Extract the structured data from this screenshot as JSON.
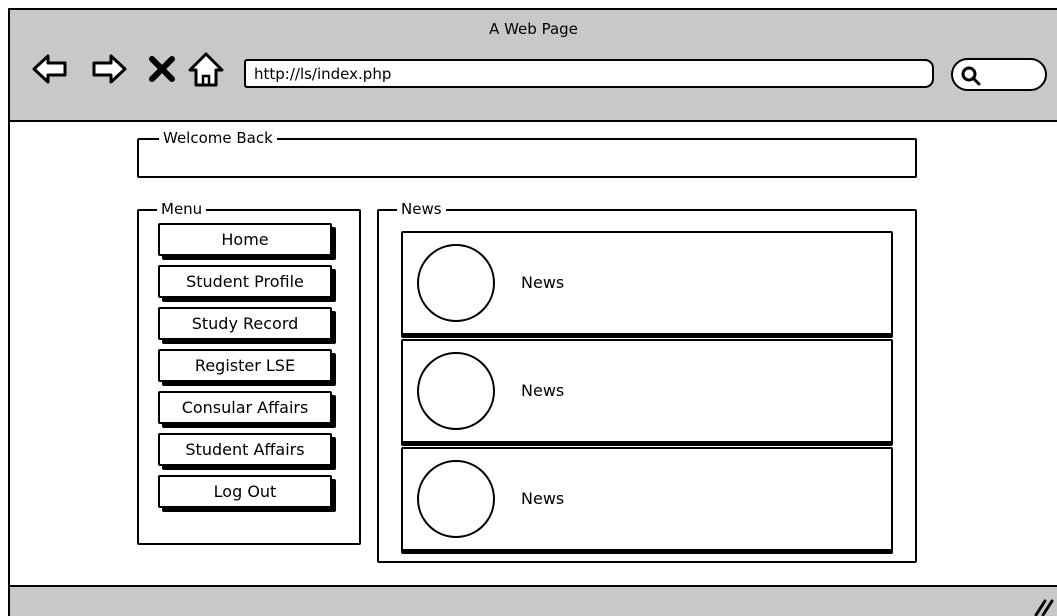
{
  "window": {
    "title": "A Web Page"
  },
  "toolbar": {
    "back_icon": "arrow-left-icon",
    "forward_icon": "arrow-right-icon",
    "stop_icon": "close-icon",
    "home_icon": "home-icon",
    "url": "http://ls/index.php",
    "search_icon": "search-icon"
  },
  "welcome": {
    "label": "Welcome Back"
  },
  "menu": {
    "label": "Menu",
    "items": [
      {
        "label": "Home"
      },
      {
        "label": "Student Profile"
      },
      {
        "label": "Study Record"
      },
      {
        "label": "Register LSE"
      },
      {
        "label": "Consular Affairs"
      },
      {
        "label": "Student Affairs"
      },
      {
        "label": "Log Out"
      }
    ]
  },
  "news": {
    "label": "News",
    "items": [
      {
        "title": "News"
      },
      {
        "title": "News"
      },
      {
        "title": "News"
      }
    ]
  },
  "statusbar": {
    "grip_icon": "resize-grip-icon"
  },
  "colors": {
    "chrome": "#c8c8c8",
    "ink": "#000000",
    "paper": "#ffffff"
  }
}
